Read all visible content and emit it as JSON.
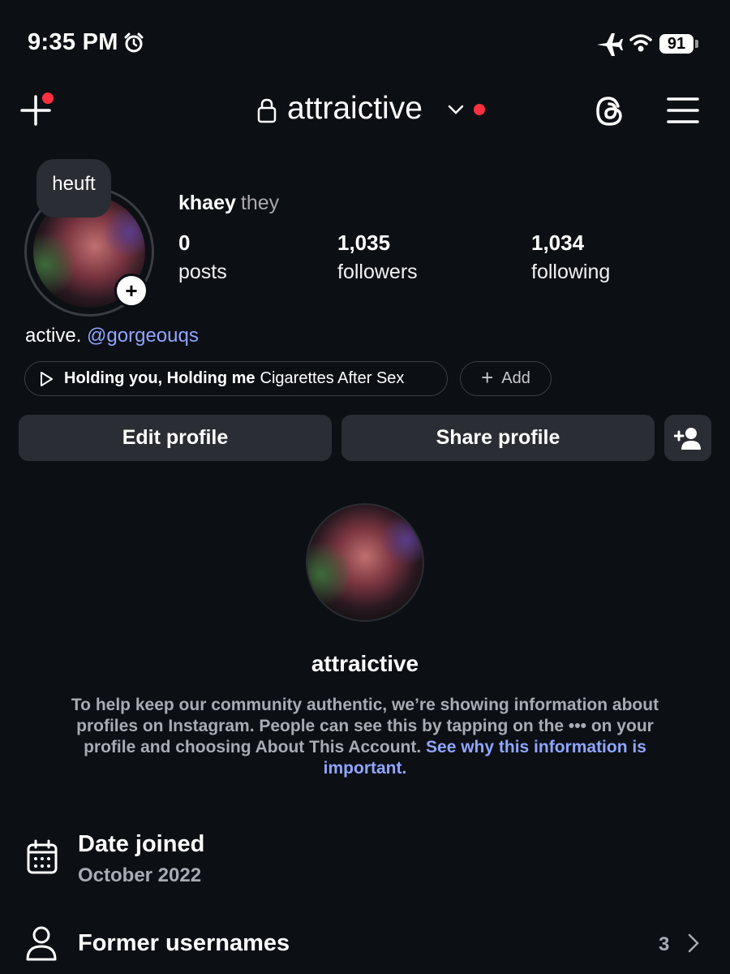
{
  "status_bar": {
    "time": "9:35 PM",
    "battery": "91"
  },
  "header": {
    "username": "attraictive"
  },
  "note": {
    "text": "heuft"
  },
  "profile": {
    "display_name": "khaey",
    "pronouns": "they",
    "stats": [
      {
        "count": "0",
        "label": "posts"
      },
      {
        "count": "1,035",
        "label": "followers"
      },
      {
        "count": "1,034",
        "label": "following"
      }
    ],
    "bio_text": "active.",
    "bio_mention": "@gorgeouqs"
  },
  "music": {
    "song": "Holding you, Holding me",
    "artist": "Cigarettes After Sex",
    "add_label": "Add"
  },
  "buttons": {
    "edit": "Edit profile",
    "share": "Share profile"
  },
  "about": {
    "username": "attraictive",
    "description": "To help keep our community authentic, we’re showing information about profiles on Instagram. People can see this by tapping on the ••• on your profile and choosing About This Account.",
    "link": "See why this information is important.",
    "date_joined_label": "Date joined",
    "date_joined_value": "October 2022",
    "former_usernames_label": "Former usernames",
    "former_usernames_count": "3"
  },
  "colors": {
    "background": "#0c0f14",
    "accent_link": "#8ea6ff",
    "notification_dot": "#ff3040",
    "button_bg": "#2a2d33"
  },
  "icons": [
    "alarm-icon",
    "airplane-icon",
    "wifi-icon",
    "plus-icon",
    "lock-icon",
    "chevron-down-icon",
    "threads-icon",
    "menu-icon",
    "play-icon",
    "add-user-icon",
    "calendar-icon",
    "person-icon",
    "chevron-right-icon"
  ]
}
